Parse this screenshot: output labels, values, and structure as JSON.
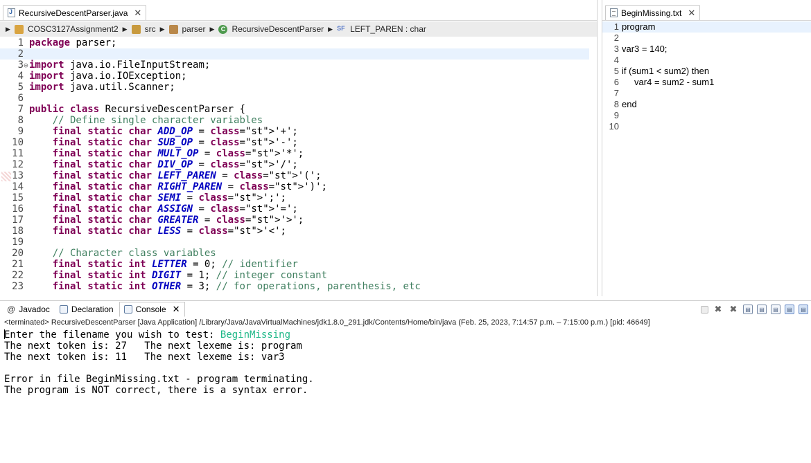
{
  "left_editor": {
    "tab_label": "RecursiveDescentParser.java",
    "breadcrumb": {
      "project": "COSC3127Assignment2",
      "folder": "src",
      "package": "parser",
      "class": "RecursiveDescentParser",
      "field": "LEFT_PAREN : char"
    },
    "lines": [
      {
        "n": "1",
        "code": "package parser;"
      },
      {
        "n": "2",
        "code": ""
      },
      {
        "n": "3",
        "code": "import java.io.FileInputStream;"
      },
      {
        "n": "4",
        "code": "import java.io.IOException;"
      },
      {
        "n": "5",
        "code": "import java.util.Scanner;"
      },
      {
        "n": "6",
        "code": ""
      },
      {
        "n": "7",
        "code": "public class RecursiveDescentParser {"
      },
      {
        "n": "8",
        "code": "    // Define single character variables"
      },
      {
        "n": "9",
        "code": "    final static char ADD_OP = '+';"
      },
      {
        "n": "10",
        "code": "    final static char SUB_OP = '-';"
      },
      {
        "n": "11",
        "code": "    final static char MULT_OP = '*';"
      },
      {
        "n": "12",
        "code": "    final static char DIV_OP = '/';"
      },
      {
        "n": "13",
        "code": "    final static char LEFT_PAREN = '(';"
      },
      {
        "n": "14",
        "code": "    final static char RIGHT_PAREN = ')';"
      },
      {
        "n": "15",
        "code": "    final static char SEMI = ';';"
      },
      {
        "n": "16",
        "code": "    final static char ASSIGN = '=';"
      },
      {
        "n": "17",
        "code": "    final static char GREATER = '>';"
      },
      {
        "n": "18",
        "code": "    final static char LESS = '<';"
      },
      {
        "n": "19",
        "code": ""
      },
      {
        "n": "20",
        "code": "    // Character class variables"
      },
      {
        "n": "21",
        "code": "    final static int LETTER = 0; // identifier"
      },
      {
        "n": "22",
        "code": "    final static int DIGIT = 1; // integer constant"
      },
      {
        "n": "23",
        "code": "    final static int OTHER = 3; // for operations, parenthesis, etc"
      }
    ]
  },
  "right_editor": {
    "tab_label": "BeginMissing.txt",
    "lines": [
      {
        "n": "1",
        "code": "program"
      },
      {
        "n": "2",
        "code": ""
      },
      {
        "n": "3",
        "code": "var3 = 140;"
      },
      {
        "n": "4",
        "code": ""
      },
      {
        "n": "5",
        "code": "if (sum1 < sum2) then"
      },
      {
        "n": "6",
        "code": "     var4 = sum2 - sum1"
      },
      {
        "n": "7",
        "code": ""
      },
      {
        "n": "8",
        "code": "end"
      },
      {
        "n": "9",
        "code": ""
      },
      {
        "n": "10",
        "code": ""
      }
    ]
  },
  "console": {
    "tabs": [
      {
        "label": "Javadoc",
        "icon": "at-icon"
      },
      {
        "label": "Declaration",
        "icon": "declaration-icon"
      },
      {
        "label": "Console",
        "icon": "console-icon"
      }
    ],
    "terminated_line": "<terminated> RecursiveDescentParser [Java Application] /Library/Java/JavaVirtualMachines/jdk1.8.0_291.jdk/Contents/Home/bin/java  (Feb. 25, 2023, 7:14:57 p.m. – 7:15:00 p.m.) [pid: 46649]",
    "prompt": "Enter the filename you wish to test: ",
    "user_input": "BeginMissing",
    "output": [
      "The next token is: 27   The next lexeme is: program",
      "The next token is: 11   The next lexeme is: var3",
      "",
      "Error in file BeginMissing.txt - program terminating.",
      "The program is NOT correct, there is a syntax error."
    ]
  },
  "colors": {
    "keyword": "#7f0055",
    "comment": "#3f7f5f",
    "string": "#2a00ff",
    "field": "#0000c0",
    "console_input": "#1fb888",
    "current_line": "#e8f2fe"
  }
}
